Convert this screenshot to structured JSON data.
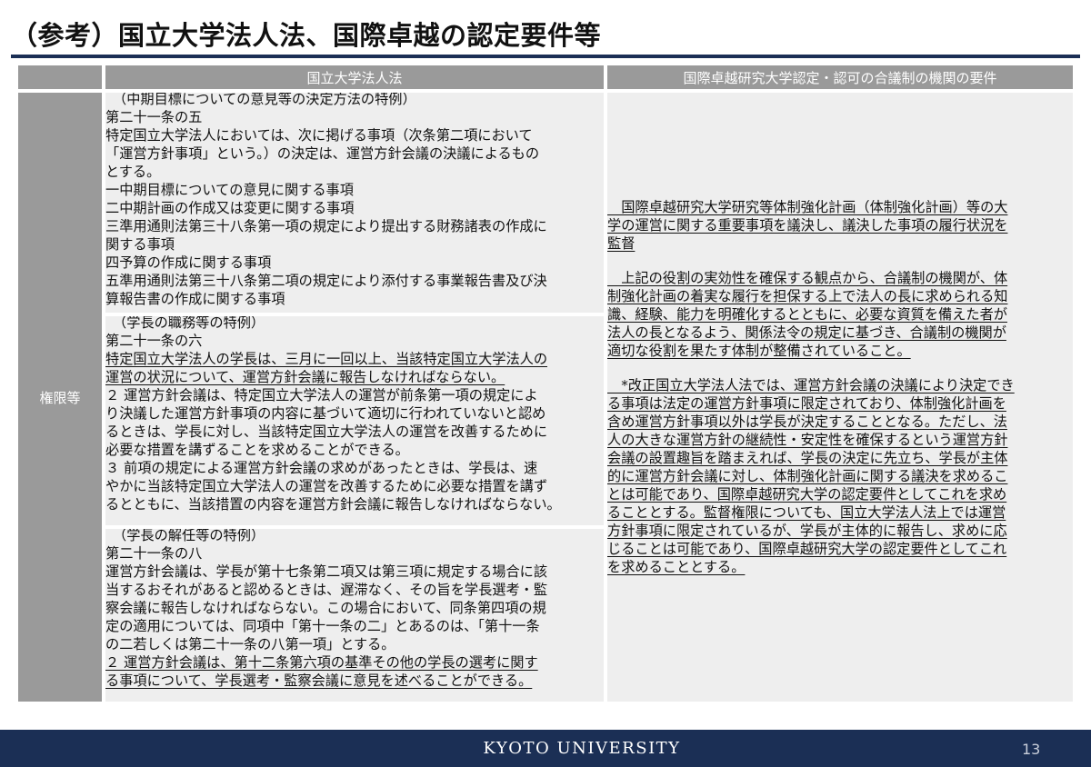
{
  "title": "（参考）国立大学法人法、国際卓越の認定要件等",
  "table": {
    "header_left": "国立大学法人法",
    "header_right": "国際卓越研究大学認定・認可の合議制の機関の要件",
    "row_label": "権限等",
    "left_blocks": [
      [
        "（中期目標についての意見等の決定方法の特例）",
        "第二十一条の五",
        "特定国立大学法人においては、次に掲げる事項（次条第二項において",
        "「運営方針事項」という。）の決定は、運営方針会議の決議によるもの",
        "とする。",
        "一中期目標についての意見に関する事項",
        "二中期計画の作成又は変更に関する事項",
        "三準用通則法第三十八条第一項の規定により提出する財務諸表の作成に",
        "関する事項",
        "四予算の作成に関する事項",
        "五準用通則法第三十八条第二項の規定により添付する事業報告書及び決",
        "算報告書の作成に関する事項"
      ],
      [
        "（学長の職務等の特例）",
        "第二十一条の六",
        "特定国立大学法人の学長は、三月に一回以上、当該特定国立大学法人の",
        "運営の状況について、運営方針会議に報告しなければならない。",
        "２ 運営方針会議は、特定国立大学法人の運営が前条第一項の規定によ",
        "り決議した運営方針事項の内容に基づいて適切に行われていないと認め",
        "るときは、学長に対し、当該特定国立大学法人の運営を改善するために",
        "必要な措置を講ずることを求めることができる。",
        "３ 前項の規定による運営方針会議の求めがあったときは、学長は、速",
        "やかに当該特定国立大学法人の運営を改善するために必要な措置を講ず",
        "るとともに、当該措置の内容を運営方針会議に報告しなければならない。"
      ],
      [
        "（学長の解任等の特例）",
        "第二十一条の八",
        "運営方針会議は、学長が第十七条第二項又は第三項に規定する場合に該",
        "当するおそれがあると認めるときは、遅滞なく、その旨を学長選考・監",
        "察会議に報告しなければならない。この場合において、同条第四項の規",
        "定の適用については、同項中「第十一条の二」とあるのは、「第十一条",
        "の二若しくは第二十一条の八第一項」とする。",
        "２ 運営方針会議は、第十二条第六項の基準その他の学長の選考に関す",
        "る事項について、学長選考・監察会議に意見を述べることができる。"
      ]
    ],
    "right_paragraphs": [
      [
        "　国際卓越研究大学研究等体制強化計画（体制強化計画）等の大",
        "学の運営に関する重要事項を議決し、議決した事項の履行状況を",
        "監督"
      ],
      [
        "　上記の役割の実効性を確保する観点から、合議制の機関が、体",
        "制強化計画の着実な履行を担保する上で法人の長に求められる知",
        "識、経験、能力を明確化するとともに、必要な資質を備えた者が",
        "法人の長となるよう、関係法令の規定に基づき、合議制の機関が",
        "適切な役割を果たす体制が整備されていること。"
      ],
      [
        "　*改正国立大学法人法では、運営方針会議の決議により決定でき",
        "る事項は法定の運営方針事項に限定されており、体制強化計画を",
        "含め運営方針事項以外は学長が決定することとなる。ただし、法",
        "人の大きな運営方針の継続性・安定性を確保するという運営方針",
        "会議の設置趣旨を踏まえれば、学長の決定に先立ち、学長が主体",
        "的に運営方針会議に対し、体制強化計画に関する議決を求めるこ",
        "とは可能であり、国際卓越研究大学の認定要件としてこれを求め",
        "ることとする。監督権限についても、国立大学法人法上では運営",
        "方針事項に限定されているが、学長が主体的に報告し、求めに応",
        "じることは可能であり、国際卓越研究大学の認定要件としてこれ",
        "を求めることとする。"
      ]
    ]
  },
  "footer": {
    "brand": "KYOTO UNIVERSITY",
    "page_number": "13"
  },
  "colors": {
    "navy": "#1b2f55",
    "header_gray": "#9a9a9a",
    "cell_gray": "#eeeeee"
  }
}
